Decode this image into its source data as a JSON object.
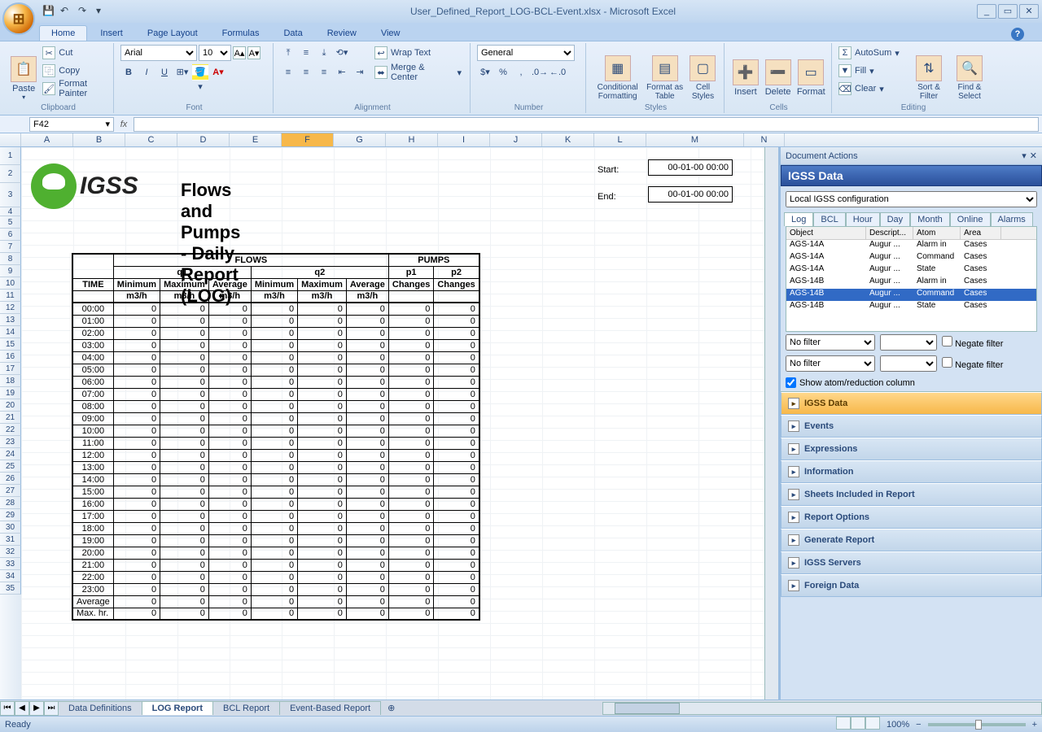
{
  "app": {
    "title": "User_Defined_Report_LOG-BCL-Event.xlsx - Microsoft Excel",
    "status": "Ready",
    "zoom": "100%"
  },
  "ribbon": {
    "tabs": [
      "Home",
      "Insert",
      "Page Layout",
      "Formulas",
      "Data",
      "Review",
      "View"
    ],
    "active_tab": "Home",
    "clipboard": {
      "paste": "Paste",
      "cut": "Cut",
      "copy": "Copy",
      "fmt": "Format Painter",
      "label": "Clipboard"
    },
    "font": {
      "name": "Arial",
      "size": "10",
      "label": "Font"
    },
    "alignment": {
      "wrap": "Wrap Text",
      "merge": "Merge & Center",
      "label": "Alignment"
    },
    "number": {
      "format": "General",
      "label": "Number"
    },
    "styles": {
      "cond": "Conditional Formatting",
      "fas": "Format as Table",
      "cell": "Cell Styles",
      "label": "Styles"
    },
    "cells": {
      "ins": "Insert",
      "del": "Delete",
      "fmt": "Format",
      "label": "Cells"
    },
    "editing": {
      "sum": "AutoSum",
      "fill": "Fill",
      "clear": "Clear",
      "sort": "Sort & Filter",
      "find": "Find & Select",
      "label": "Editing"
    }
  },
  "formula": {
    "name_box": "F42",
    "value": ""
  },
  "columns": [
    "A",
    "B",
    "C",
    "D",
    "E",
    "F",
    "G",
    "H",
    "I",
    "J",
    "K",
    "L",
    "M",
    "N"
  ],
  "selected_col": "F",
  "rows_visible": 35,
  "report": {
    "logo_text": "IGSS",
    "title": "Flows and Pumps - Daily Report (LOG)",
    "start_label": "Start:",
    "end_label": "End:",
    "start_value": "00-01-00 00:00",
    "end_value": "00-01-00 00:00",
    "section_flows": "FLOWS",
    "section_pumps": "PUMPS",
    "q1": "q1",
    "q2": "q2",
    "p1": "p1",
    "p2": "p2",
    "time": "TIME",
    "min": "Minimum",
    "max": "Maximum",
    "avg": "Average",
    "unit": "m3/h",
    "changes": "Changes",
    "times": [
      "00:00",
      "01:00",
      "02:00",
      "03:00",
      "04:00",
      "05:00",
      "06:00",
      "07:00",
      "08:00",
      "09:00",
      "10:00",
      "11:00",
      "12:00",
      "13:00",
      "14:00",
      "15:00",
      "16:00",
      "17:00",
      "18:00",
      "19:00",
      "20:00",
      "21:00",
      "22:00",
      "23:00"
    ],
    "summary": [
      "Average",
      "Max. hr."
    ]
  },
  "sheet_tabs": {
    "tabs": [
      "Data Definitions",
      "LOG Report",
      "BCL Report",
      "Event-Based Report"
    ],
    "active": "LOG Report"
  },
  "panel": {
    "title": "Document Actions",
    "header": "IGSS Data",
    "config": "Local IGSS configuration",
    "tabs": [
      "Log",
      "BCL",
      "Hour",
      "Day",
      "Month",
      "Online",
      "Alarms"
    ],
    "active_tab": "Log",
    "columns": [
      "Object",
      "Descript...",
      "Atom",
      "Area"
    ],
    "rows": [
      {
        "obj": "AGS-14A",
        "desc": "Augur ...",
        "atom": "Alarm in",
        "area": "Cases"
      },
      {
        "obj": "AGS-14A",
        "desc": "Augur ...",
        "atom": "Command",
        "area": "Cases"
      },
      {
        "obj": "AGS-14A",
        "desc": "Augur ...",
        "atom": "State",
        "area": "Cases"
      },
      {
        "obj": "AGS-14B",
        "desc": "Augur ...",
        "atom": "Alarm in",
        "area": "Cases"
      },
      {
        "obj": "AGS-14B",
        "desc": "Augur ...",
        "atom": "Command",
        "area": "Cases",
        "selected": true
      },
      {
        "obj": "AGS-14B",
        "desc": "Augur ...",
        "atom": "State",
        "area": "Cases"
      }
    ],
    "no_filter": "No filter",
    "negate": "Negate filter",
    "show_atom": "Show atom/reduction column",
    "accordion": [
      "IGSS Data",
      "Events",
      "Expressions",
      "Information",
      "Sheets Included in Report",
      "Report Options",
      "Generate Report",
      "IGSS Servers",
      "Foreign Data"
    ],
    "accordion_active": "IGSS Data"
  }
}
